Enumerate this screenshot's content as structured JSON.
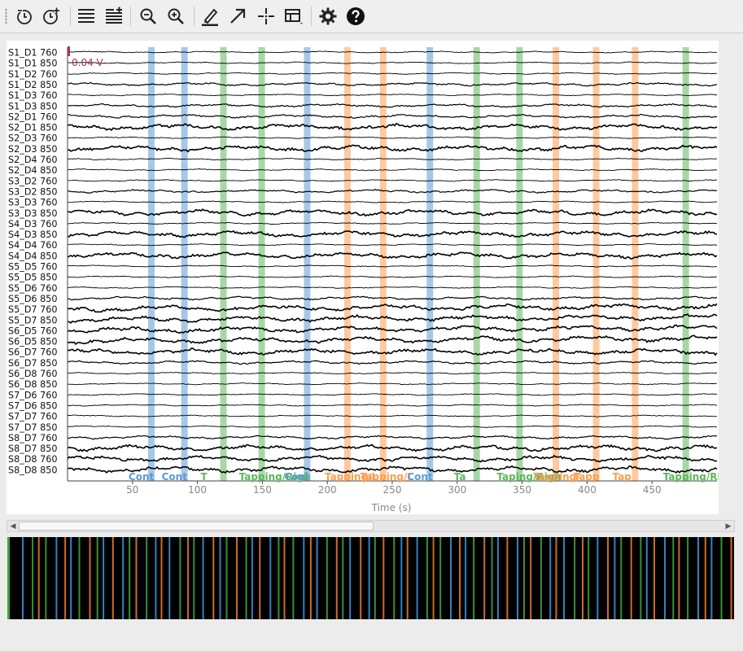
{
  "toolbar": {
    "buttons": [
      {
        "name": "decrease-duration-button",
        "icon": "clock-minus-icon"
      },
      {
        "name": "increase-duration-button",
        "icon": "clock-plus-icon"
      },
      {
        "name": "decrease-channels-button",
        "icon": "lines-minus-icon"
      },
      {
        "name": "increase-channels-button",
        "icon": "lines-plus-icon"
      },
      {
        "name": "zoom-out-button",
        "icon": "zoom-out-icon"
      },
      {
        "name": "zoom-in-button",
        "icon": "zoom-in-icon"
      },
      {
        "name": "annotation-mode-button",
        "icon": "pencil-icon"
      },
      {
        "name": "mark-button",
        "icon": "arrow-icon"
      },
      {
        "name": "crosshair-button",
        "icon": "crosshair-icon"
      },
      {
        "name": "overview-bar-button",
        "icon": "overview-icon"
      },
      {
        "name": "settings-button",
        "icon": "gear-icon"
      },
      {
        "name": "help-button",
        "icon": "help-icon"
      }
    ]
  },
  "plot": {
    "channels": [
      "S1_D1 760",
      "S1_D1 850",
      "S1_D2 760",
      "S1_D2 850",
      "S1_D3 760",
      "S1_D3 850",
      "S2_D1 760",
      "S2_D1 850",
      "S2_D3 760",
      "S2_D3 850",
      "S2_D4 760",
      "S2_D4 850",
      "S3_D2 760",
      "S3_D2 850",
      "S3_D3 760",
      "S3_D3 850",
      "S4_D3 760",
      "S4_D3 850",
      "S4_D4 760",
      "S4_D4 850",
      "S5_D5 760",
      "S5_D5 850",
      "S5_D6 760",
      "S5_D6 850",
      "S5_D7 760",
      "S5_D7 850",
      "S6_D5 760",
      "S6_D5 850",
      "S6_D7 760",
      "S6_D7 850",
      "S6_D8 760",
      "S6_D8 850",
      "S7_D6 760",
      "S7_D6 850",
      "S7_D7 760",
      "S7_D7 850",
      "S8_D7 760",
      "S8_D7 850",
      "S8_D8 760",
      "S8_D8 850"
    ],
    "scalebar_label": "0.04 V",
    "x_axis": {
      "label": "Time (s)",
      "ticks": [
        50,
        100,
        150,
        200,
        250,
        300,
        350,
        400,
        450
      ],
      "range": [
        0,
        500
      ]
    },
    "annotation_labels": [
      "Control",
      "Control",
      "Tapping/Right",
      "Tapping/Right",
      "Control",
      "Tapping/Left",
      "Tapping/Left",
      "Control",
      "Tapping/Right",
      "Tapping/Right",
      "Tapping/Left",
      "Tapping/Left",
      "Tapping/Left",
      "Tapping/Right"
    ],
    "annotation_labels_display": [
      "Cont",
      "Cont",
      "T",
      "Tapping/Righ",
      "Conl",
      "Tapping/L",
      "Tapping/L",
      "Cont",
      "Ta",
      "Taping/Righ",
      "Tapping/",
      "Tapp",
      "Tap",
      "Tapping/Rig"
    ]
  },
  "annotation_colors": {
    "Control": "#5b9bd5",
    "Tapping/Left": "#ff9d4d",
    "Tapping/Right": "#5cb85c",
    "overview_control": "#3a8fd0",
    "overview_left": "#e0782a",
    "overview_right": "#3f9f3f"
  },
  "scrollbar": {
    "left_arrow": "◀",
    "right_arrow": "▶",
    "position_fraction": 0.0,
    "visible_fraction": 0.5
  }
}
